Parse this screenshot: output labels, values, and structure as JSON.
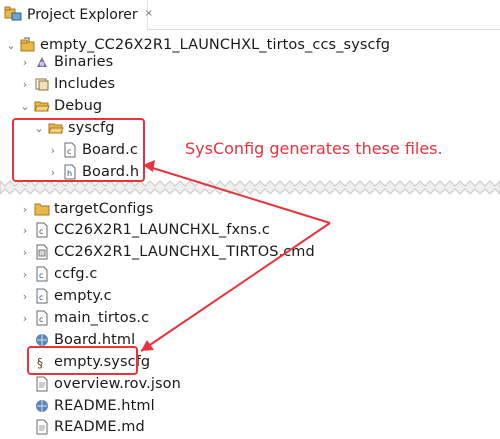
{
  "view": {
    "tab_title": "Project Explorer",
    "close_glyph": "×"
  },
  "tree": {
    "project": "empty_CC26X2R1_LAUNCHXL_tirtos_ccs_syscfg",
    "binaries": "Binaries",
    "includes": "Includes",
    "debug": "Debug",
    "syscfg": "syscfg",
    "board_c": "Board.c",
    "board_h": "Board.h",
    "targetconfigs": "targetConfigs",
    "fxns_c": "CC26X2R1_LAUNCHXL_fxns.c",
    "tirtos_cmd": "CC26X2R1_LAUNCHXL_TIRTOS.cmd",
    "ccfg_c": "ccfg.c",
    "empty_c": "empty.c",
    "main_tirtos_c": "main_tirtos.c",
    "board_html": "Board.html",
    "empty_syscfg": "empty.syscfg",
    "overview_json": "overview.rov.json",
    "readme_html": "README.html",
    "readme_md": "README.md"
  },
  "annotation": {
    "text": "SysConfig generates these files.",
    "color": "#e8323c"
  }
}
